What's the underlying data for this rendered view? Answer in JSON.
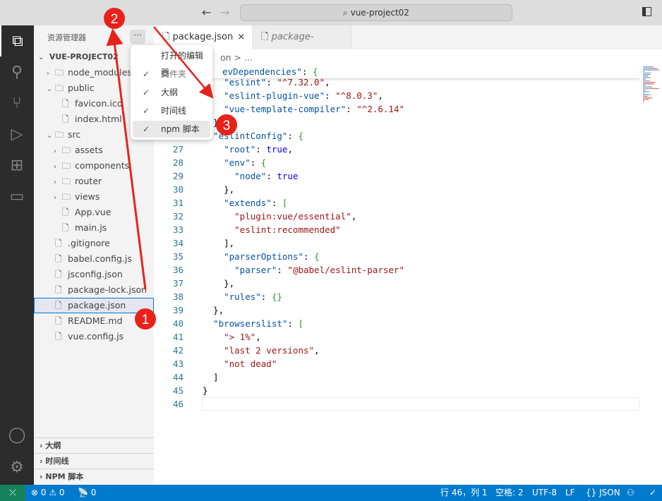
{
  "titlebar": {
    "search": "vue-project02",
    "back": "←",
    "forward": "→"
  },
  "activity": [
    "files-icon",
    "search-icon",
    "source-control-icon",
    "run-debug-icon",
    "extensions-icon",
    "remote-explorer-icon"
  ],
  "sidebar": {
    "title": "资源管理器",
    "more": "···",
    "root": "VUE-PROJECT02",
    "items": [
      {
        "label": "node_modules",
        "type": "folder",
        "depth": 1,
        "open": false
      },
      {
        "label": "public",
        "type": "folder",
        "depth": 1,
        "open": true
      },
      {
        "label": "favicon.ico",
        "type": "file",
        "depth": 2
      },
      {
        "label": "index.html",
        "type": "file",
        "depth": 2
      },
      {
        "label": "src",
        "type": "folder",
        "depth": 1,
        "open": true
      },
      {
        "label": "assets",
        "type": "folder",
        "depth": 2,
        "open": false
      },
      {
        "label": "components",
        "type": "folder",
        "depth": 2,
        "open": false
      },
      {
        "label": "router",
        "type": "folder",
        "depth": 2,
        "open": false
      },
      {
        "label": "views",
        "type": "folder",
        "depth": 2,
        "open": false
      },
      {
        "label": "App.vue",
        "type": "file",
        "depth": 2
      },
      {
        "label": "main.js",
        "type": "file",
        "depth": 2
      },
      {
        "label": ".gitignore",
        "type": "file",
        "depth": 1
      },
      {
        "label": "babel.config.js",
        "type": "file",
        "depth": 1
      },
      {
        "label": "jsconfig.json",
        "type": "file",
        "depth": 1
      },
      {
        "label": "package-lock.json",
        "type": "file",
        "depth": 1
      },
      {
        "label": "package.json",
        "type": "file",
        "depth": 1,
        "selected": true
      },
      {
        "label": "README.md",
        "type": "file",
        "depth": 1
      },
      {
        "label": "vue.config.js",
        "type": "file",
        "depth": 1
      }
    ],
    "panels": [
      "大纲",
      "时间线",
      "NPM 脚本"
    ]
  },
  "tabs": [
    {
      "label": "package.json",
      "active": true,
      "close": "×"
    },
    {
      "label": "package-lock.json",
      "active": false
    }
  ],
  "breadcrumb": "on > ...",
  "sticky": [
    [
      "k",
      "evDependencies\""
    ],
    [
      "p",
      ": "
    ],
    [
      "br",
      "{"
    ]
  ],
  "code_start": 22,
  "code": [
    [
      [
        "k",
        "    \"eslint\""
      ],
      [
        "p",
        ": "
      ],
      [
        "s",
        "\"^7.32.0\""
      ],
      [
        "p",
        ","
      ]
    ],
    [
      [
        "k",
        "    \"eslint-plugin-vue\""
      ],
      [
        "p",
        ": "
      ],
      [
        "s",
        "\"^8.0.3\""
      ],
      [
        "p",
        ","
      ]
    ],
    [
      [
        "k",
        "    \"vue-template-compiler\""
      ],
      [
        "p",
        ": "
      ],
      [
        "s",
        "\"^2.6.14\""
      ]
    ],
    [
      [
        "p",
        "  },"
      ]
    ],
    [
      [
        "k",
        "  \"eslintConfig\""
      ],
      [
        "p",
        ": "
      ],
      [
        "br",
        "{"
      ]
    ],
    [
      [
        "k",
        "    \"root\""
      ],
      [
        "p",
        ": "
      ],
      [
        "b",
        "true"
      ],
      [
        "p",
        ","
      ]
    ],
    [
      [
        "k",
        "    \"env\""
      ],
      [
        "p",
        ": "
      ],
      [
        "br",
        "{"
      ]
    ],
    [
      [
        "k",
        "      \"node\""
      ],
      [
        "p",
        ": "
      ],
      [
        "b",
        "true"
      ]
    ],
    [
      [
        "p",
        "    },"
      ]
    ],
    [
      [
        "k",
        "    \"extends\""
      ],
      [
        "p",
        ": "
      ],
      [
        "br",
        "["
      ]
    ],
    [
      [
        "s",
        "      \"plugin:vue/essential\""
      ],
      [
        "p",
        ","
      ]
    ],
    [
      [
        "s",
        "      \"eslint:recommended\""
      ]
    ],
    [
      [
        "p",
        "    ],"
      ]
    ],
    [
      [
        "k",
        "    \"parserOptions\""
      ],
      [
        "p",
        ": "
      ],
      [
        "br",
        "{"
      ]
    ],
    [
      [
        "k",
        "      \"parser\""
      ],
      [
        "p",
        ": "
      ],
      [
        "s",
        "\"@babel/eslint-parser\""
      ]
    ],
    [
      [
        "p",
        "    },"
      ]
    ],
    [
      [
        "k",
        "    \"rules\""
      ],
      [
        "p",
        ": "
      ],
      [
        "br",
        "{}"
      ]
    ],
    [
      [
        "p",
        "  },"
      ]
    ],
    [
      [
        "k",
        "  \"browserslist\""
      ],
      [
        "p",
        ": "
      ],
      [
        "br",
        "["
      ]
    ],
    [
      [
        "s",
        "    \"> 1%\""
      ],
      [
        "p",
        ","
      ]
    ],
    [
      [
        "s",
        "    \"last 2 versions\""
      ],
      [
        "p",
        ","
      ]
    ],
    [
      [
        "s",
        "    \"not dead\""
      ]
    ],
    [
      [
        "p",
        "  ]"
      ]
    ],
    [
      [
        "p",
        "}"
      ]
    ],
    []
  ],
  "menu": [
    {
      "label": "打开的编辑器",
      "checked": false
    },
    {
      "label": "文件夹",
      "checked": true,
      "dim": true
    },
    {
      "label": "大纲",
      "checked": true
    },
    {
      "label": "时间线",
      "checked": true
    },
    {
      "label": "npm 脚本",
      "checked": true,
      "hover": true
    }
  ],
  "menu_check": "✓",
  "annotations": [
    "1",
    "2",
    "3"
  ],
  "status": {
    "errors": "0",
    "warnings": "0",
    "ports": "0",
    "position": "行 46，列 1",
    "spaces": "空格: 2",
    "encoding": "UTF-8",
    "eol": "LF",
    "language": "JSON",
    "check": "✓"
  },
  "colors": {
    "accent": "#007acc",
    "remote": "#16825d",
    "annotation": "#e8221b"
  }
}
